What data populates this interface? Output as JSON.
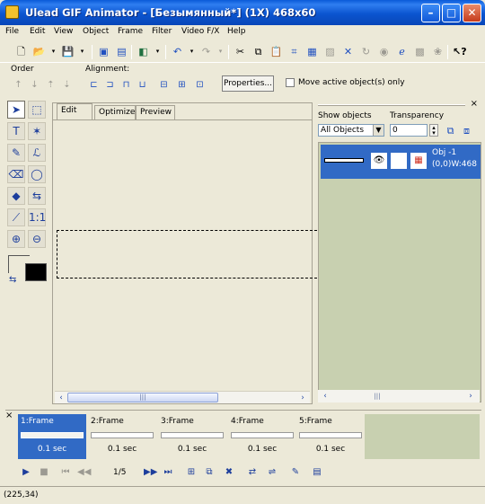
{
  "window": {
    "title": "Ulead GIF Animator - [Безымянный*] (1X) 468x60",
    "minimize_label": "–",
    "maximize_label": "□",
    "close_label": "✕"
  },
  "menu": [
    "File",
    "Edit",
    "View",
    "Object",
    "Frame",
    "Filter",
    "Video F/X",
    "Help"
  ],
  "options": {
    "order_label": "Order",
    "alignment_label": "Alignment:",
    "properties_label": "Properties...",
    "move_active_label": "Move active object(s) only"
  },
  "canvas": {
    "tabs": [
      "Edit",
      "Optimize",
      "Preview"
    ],
    "active_tab": "Edit"
  },
  "objects_panel": {
    "show_objects_label": "Show objects",
    "transparency_label": "Transparency",
    "show_objects_value": "All Objects",
    "transparency_value": "0",
    "object": {
      "name": "Obj -1",
      "position": "(0,0)W:468"
    }
  },
  "frames": [
    {
      "name": "1:Frame",
      "delay": "0.1 sec",
      "selected": true
    },
    {
      "name": "2:Frame",
      "delay": "0.1 sec",
      "selected": false
    },
    {
      "name": "3:Frame",
      "delay": "0.1 sec",
      "selected": false
    },
    {
      "name": "4:Frame",
      "delay": "0.1 sec",
      "selected": false
    },
    {
      "name": "5:Frame",
      "delay": "0.1 sec",
      "selected": false
    }
  ],
  "playback": {
    "frame_counter": "1/5"
  },
  "status": {
    "coordinates": "(225,34)"
  },
  "icons": {
    "scroll_left": "‹",
    "scroll_right": "›",
    "scroll_grip": "|||",
    "eye": "👁",
    "close_small": "×"
  },
  "colors": {
    "title_blue": "#0b55d0",
    "selection_blue": "#316ac5",
    "panel_olive": "#c8d0b0",
    "foreground_color": "#000000",
    "background_color": "#ffffff"
  }
}
